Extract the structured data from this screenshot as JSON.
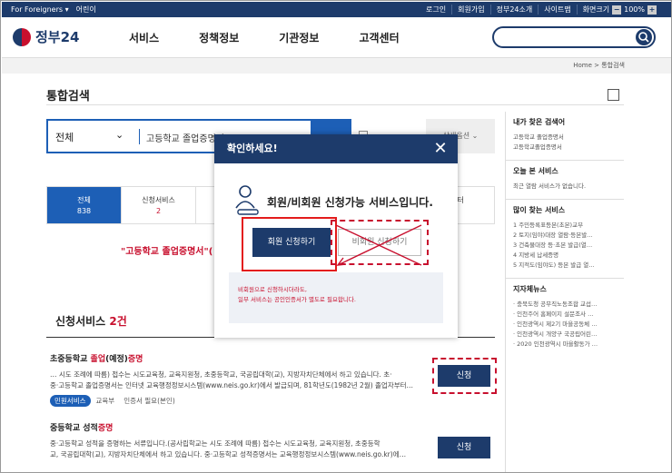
{
  "topbar": {
    "foreigners": "For Foreigners ▾",
    "kids": "어린이",
    "login": "로그인",
    "signup": "회원가입",
    "about": "정부24소개",
    "sitemap": "사이트맵",
    "screen_size": "화면크기",
    "zoom_level": "100%"
  },
  "header": {
    "logo": "정부24",
    "nav": [
      "서비스",
      "정책정보",
      "기관정보",
      "고객센터"
    ]
  },
  "breadcrumb": "Home  >  통합검색",
  "page": {
    "title": "통합검색",
    "search_scope": "전체",
    "search_value": "고등학교 졸업증명서",
    "detail_option": "상세옵션 ⌄"
  },
  "tabs": [
    {
      "label": "전체",
      "count": "838"
    },
    {
      "label": "신청서비스",
      "count": "2"
    },
    {
      "label": "센터",
      "count": ""
    }
  ],
  "notice": "\"고등학교 졸업증명서\"(",
  "section": {
    "title": "신청서비스",
    "count": "2건"
  },
  "items": [
    {
      "title_a": "초중등학교 ",
      "title_hl1": "졸업",
      "title_b": "(예정)",
      "title_hl2": "증명",
      "desc1": "… 시도 조례에 따름) 접수는 시도교육청, 교육지원청, 초중등학교, 국공립대학(교), 지방자치단체에서 하고 있습니다. 초·",
      "desc2": "중·고등학교 졸업증명서는 인터넷 교육행정정보시스템(www.neis.go.kr)에서 발급되며, 81학년도(1982년 2월) 졸업자부터…",
      "badge": "민원서비스",
      "meta1": "교육부",
      "meta2": "인증서 필요(본인)",
      "apply": "신청"
    },
    {
      "title_a": "중등학교 성적",
      "title_hl1": "증명",
      "desc1": "중·고등학교 성적을 증명하는 서류입니다.(공사립학교는 시도 조례에 따름) 접수는 시도교육청, 교육지원청, 초중등학",
      "desc2": "교, 국공립대학(교), 지방자치단체에서 하고 있습니다. 중·고등학교 성적증명서는 교육행정정보시스템(www.neis.go.kr)에…",
      "apply": "신청"
    }
  ],
  "sidebar": {
    "recent_title": "내가 찾은 검색어",
    "recent": [
      "고등학교 졸업증명서",
      "고등학교졸업증명서"
    ],
    "today_title": "오늘 본 서비스",
    "today": [
      "최근 열람 서비스가 없습니다."
    ],
    "popular_title": "많이 찾는 서비스",
    "popular": [
      "1  주민등록표등본(초본)교부",
      "2  토지(임야)대장 열람·등본발…",
      "3  건축물대장 등·초본 발급(열…",
      "4  지방세 납세증명",
      "5  지적도(임야도) 등본 발급 열…"
    ],
    "news_title": "지자체뉴스",
    "news": [
      "· 충북도청 공무직노동조합 교섭…",
      "· 인천주어 홈페이지 설문조사 …",
      "· 인천광역시 제2기 마을공동체 …",
      "· 인천광역시 개양구 국공립어린…",
      "· 2020 인천광역시 마을활동가 …"
    ]
  },
  "modal": {
    "title": "확인하세요!",
    "message": "회원/비회원 신청가능 서비스입니다.",
    "member_button": "회원 신청하기",
    "nonmember_button": "비회원 신청하기",
    "info1": "비회원으로 신청하시더라도,",
    "info2": "일부 서비스는 공인인증서가 별도로 필요합니다."
  },
  "colors": {
    "navy": "#1d3b6b",
    "blue": "#1d5fb6",
    "red": "#c8102e"
  }
}
